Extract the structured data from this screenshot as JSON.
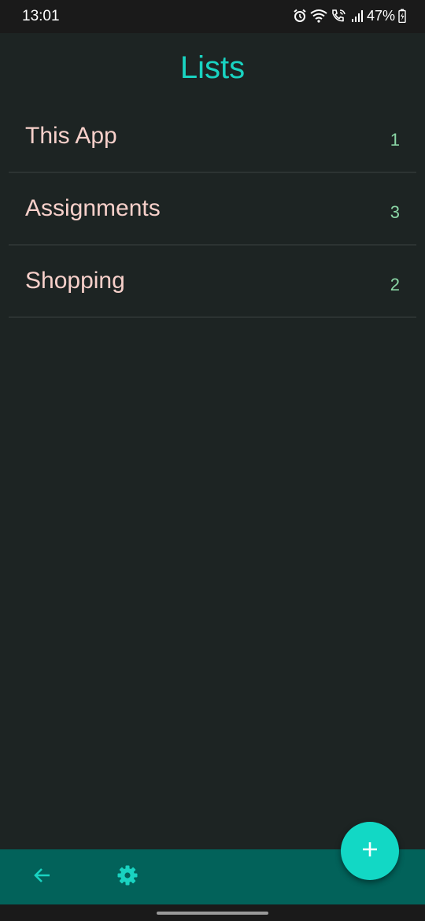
{
  "status_bar": {
    "time": "13:01",
    "battery": "47%",
    "icons": [
      "alarm-icon",
      "wifi-icon",
      "wifi-calling-icon",
      "signal-icon",
      "battery-charging-icon"
    ]
  },
  "header": {
    "title": "Lists"
  },
  "lists": [
    {
      "name": "This App",
      "count": "1"
    },
    {
      "name": "Assignments",
      "count": "3"
    },
    {
      "name": "Shopping",
      "count": "2"
    }
  ],
  "bottom_bar": {
    "back_icon": "arrow-back-icon",
    "settings_icon": "gear-icon"
  },
  "fab": {
    "icon": "plus-icon"
  },
  "colors": {
    "background": "#1d2423",
    "accent": "#19d3c1",
    "item_text": "#f7d0ca",
    "count_text": "#8bd7a6",
    "bottom_bar": "#02625a",
    "fab": "#12d8c5"
  }
}
